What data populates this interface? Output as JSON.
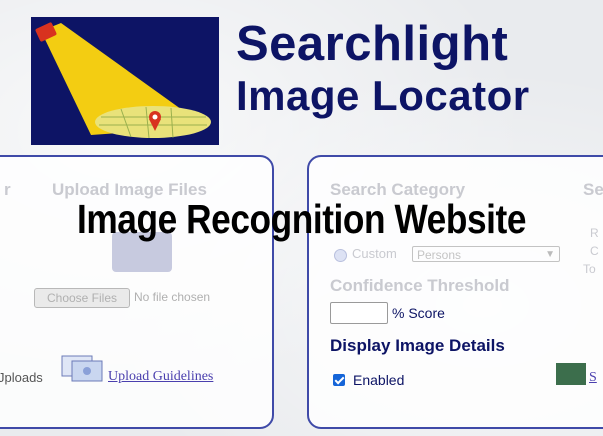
{
  "brand": {
    "line1": "Searchlight",
    "line2": "Image Locator"
  },
  "upload_panel": {
    "left_edge_fragment": "r",
    "title": "Upload Image Files",
    "choose_label": "Choose Files",
    "no_file_text": "No file chosen",
    "uploads_fragment": "Jploads",
    "guidelines_link": "Upload Guidelines"
  },
  "search_panel": {
    "title": "Search Category",
    "right_fragment": "Se",
    "custom_label": "Custom",
    "select_value": "Persons",
    "right_snippets": [
      "R",
      "C",
      "To"
    ],
    "threshold_title": "Confidence Threshold",
    "score_value": "",
    "score_suffix": "% Score",
    "details_title": "Display Image Details",
    "enabled_label": "Enabled",
    "enabled_checked": true,
    "right_link_fragment": "S"
  },
  "overlay_title": "Image Recognition Website",
  "colors": {
    "brand_navy": "#0d1465",
    "panel_border": "#3f4aa8",
    "searchlight_yellow": "#f3cd12"
  }
}
